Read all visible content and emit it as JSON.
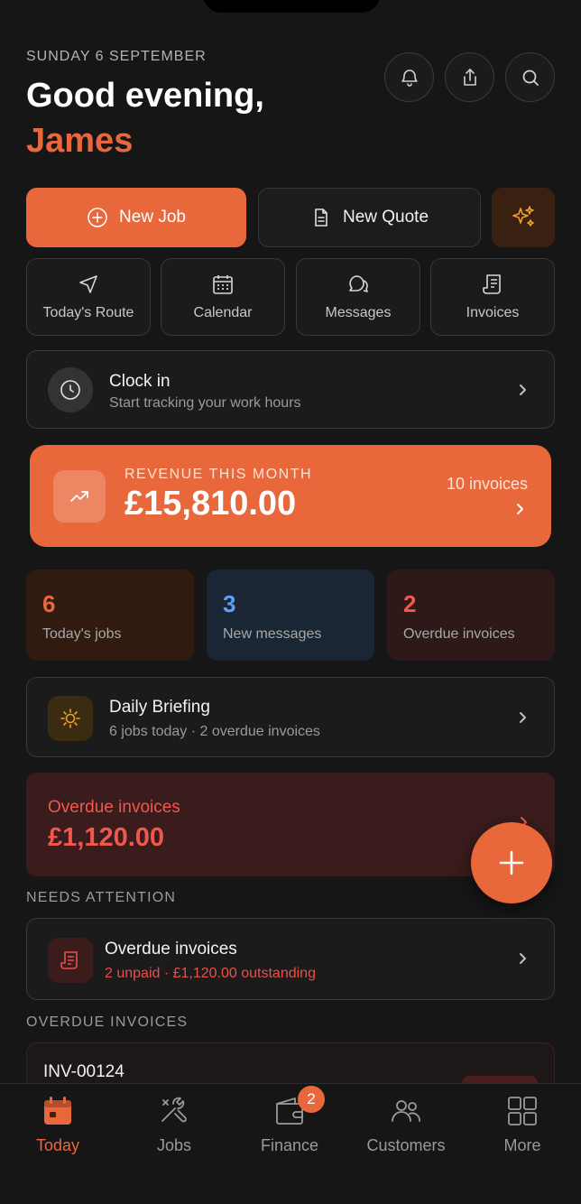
{
  "header": {
    "date": "SUNDAY 6 SEPTEMBER",
    "greeting": "Good evening,",
    "name": "James",
    "icons": [
      "bell-icon",
      "share-icon",
      "search-icon"
    ]
  },
  "actions": {
    "new_job": "New Job",
    "new_quote": "New Quote",
    "magic_icon": "sparkles-icon"
  },
  "quick_links": [
    {
      "label": "Today's Route",
      "icon": "navigation-arrow-icon"
    },
    {
      "label": "Calendar",
      "icon": "calendar-icon"
    },
    {
      "label": "Messages",
      "icon": "chat-bubbles-icon"
    },
    {
      "label": "Invoices",
      "icon": "receipt-icon"
    }
  ],
  "clock": {
    "title": "Clock in",
    "subtitle": "Start tracking your work hours"
  },
  "revenue": {
    "label": "REVENUE THIS MONTH",
    "amount": "£15,810.00",
    "invoices": "10 invoices"
  },
  "stats": [
    {
      "value": "6",
      "label": "Today's jobs",
      "color": "#e8683c"
    },
    {
      "value": "3",
      "label": "New messages",
      "color": "#5aa0f5"
    },
    {
      "value": "2",
      "label": "Overdue invoices",
      "color": "#f0584f"
    }
  ],
  "briefing": {
    "title": "Daily Briefing",
    "subtitle": "6 jobs today · 2 overdue invoices"
  },
  "overdue": {
    "title": "Overdue invoices",
    "amount": "£1,120.00"
  },
  "needs_attention": {
    "heading": "NEEDS ATTENTION",
    "title": "Overdue invoices",
    "subtitle": "2 unpaid · £1,120.00 outstanding"
  },
  "overdue_list": {
    "heading": "OVERDUE INVOICES",
    "items": [
      {
        "id": "INV-00124"
      }
    ]
  },
  "tabs": [
    {
      "label": "Today",
      "icon": "calendar-icon",
      "active": true
    },
    {
      "label": "Jobs",
      "icon": "tools-icon"
    },
    {
      "label": "Finance",
      "icon": "wallet-icon",
      "badge": "2"
    },
    {
      "label": "Customers",
      "icon": "people-icon"
    },
    {
      "label": "More",
      "icon": "grid-icon"
    }
  ],
  "colors": {
    "accent": "#e8683c",
    "danger": "#f0584f",
    "info": "#5aa0f5",
    "background": "#161617"
  }
}
